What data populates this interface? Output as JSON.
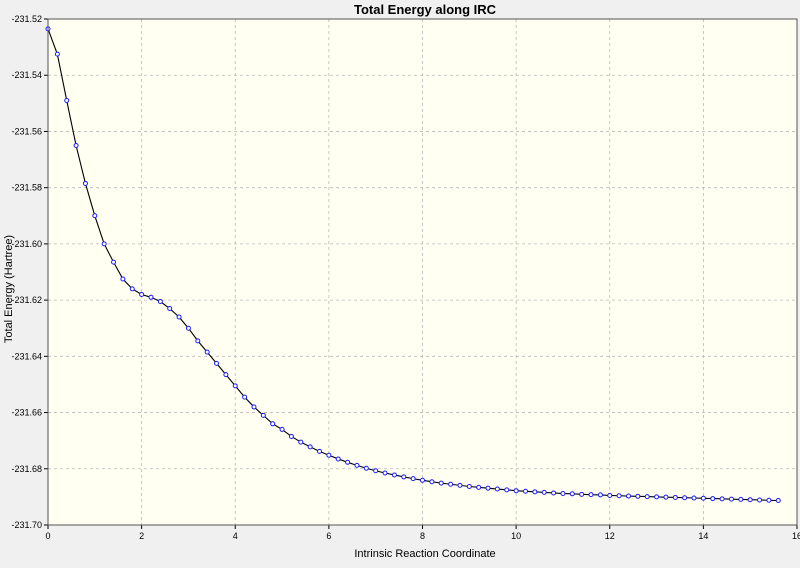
{
  "chart_data": {
    "type": "line",
    "title": "Total Energy along IRC",
    "xlabel": "Intrinsic Reaction Coordinate",
    "ylabel": "Total Energy (Hartree)",
    "xlim": [
      0,
      16
    ],
    "ylim": [
      -231.7,
      -231.52
    ],
    "xticks": [
      "0",
      "2",
      "4",
      "6",
      "8",
      "10",
      "12",
      "14",
      "16"
    ],
    "yticks": [
      "-231.52",
      "-231.54",
      "-231.56",
      "-231.58",
      "-231.60",
      "-231.62",
      "-231.64",
      "-231.66",
      "-231.68",
      "-231.70"
    ],
    "grid": true,
    "colors": {
      "plot_bg": "#fffff2",
      "line": "#000000",
      "marker": "#1a1aff",
      "window_bg": "#f0f0f0"
    },
    "series": [
      {
        "x": [
          0,
          0.2,
          0.4,
          0.6,
          0.8,
          1.0,
          1.2,
          1.4,
          1.6,
          1.8,
          2.0,
          2.2,
          2.4,
          2.6,
          2.8,
          3.0,
          3.2,
          3.4,
          3.6,
          3.8,
          4.0,
          4.2,
          4.4,
          4.6,
          4.8,
          5.0,
          5.2,
          5.4,
          5.6,
          5.8,
          6.0,
          6.2,
          6.4,
          6.6,
          6.8,
          7.0,
          7.2,
          7.4,
          7.6,
          7.8,
          8.0,
          8.2,
          8.4,
          8.6,
          8.8,
          9.0,
          9.2,
          9.4,
          9.6,
          9.8,
          10.0,
          10.2,
          10.4,
          10.6,
          10.8,
          11.0,
          11.2,
          11.4,
          11.6,
          11.8,
          12.0,
          12.2,
          12.4,
          12.6,
          12.8,
          13.0,
          13.2,
          13.4,
          13.6,
          13.8,
          14.0,
          14.2,
          14.4,
          14.6,
          14.8,
          15.0,
          15.2,
          15.4,
          15.6
        ],
        "y": [
          -231.5235,
          -231.5325,
          -231.549,
          -231.565,
          -231.5785,
          -231.59,
          -231.6,
          -231.6065,
          -231.6125,
          -231.616,
          -231.618,
          -231.619,
          -231.6205,
          -231.623,
          -231.626,
          -231.63,
          -231.6345,
          -231.6385,
          -231.6425,
          -231.6465,
          -231.6505,
          -231.6545,
          -231.658,
          -231.661,
          -231.664,
          -231.666,
          -231.6685,
          -231.6705,
          -231.6722,
          -231.6738,
          -231.6752,
          -231.6765,
          -231.6777,
          -231.6788,
          -231.6798,
          -231.6807,
          -231.6815,
          -231.6822,
          -231.6829,
          -231.6835,
          -231.6841,
          -231.6846,
          -231.6851,
          -231.6855,
          -231.6859,
          -231.6863,
          -231.6866,
          -231.6869,
          -231.6872,
          -231.6875,
          -231.6878,
          -231.688,
          -231.6882,
          -231.6884,
          -231.6886,
          -231.6888,
          -231.6889,
          -231.6891,
          -231.6892,
          -231.6893,
          -231.6895,
          -231.6896,
          -231.6897,
          -231.6898,
          -231.6899,
          -231.69,
          -231.6901,
          -231.6902,
          -231.6903,
          -231.6904,
          -231.6905,
          -231.6906,
          -231.6907,
          -231.6908,
          -231.6909,
          -231.691,
          -231.6911,
          -231.6912,
          -231.6913
        ]
      }
    ]
  }
}
